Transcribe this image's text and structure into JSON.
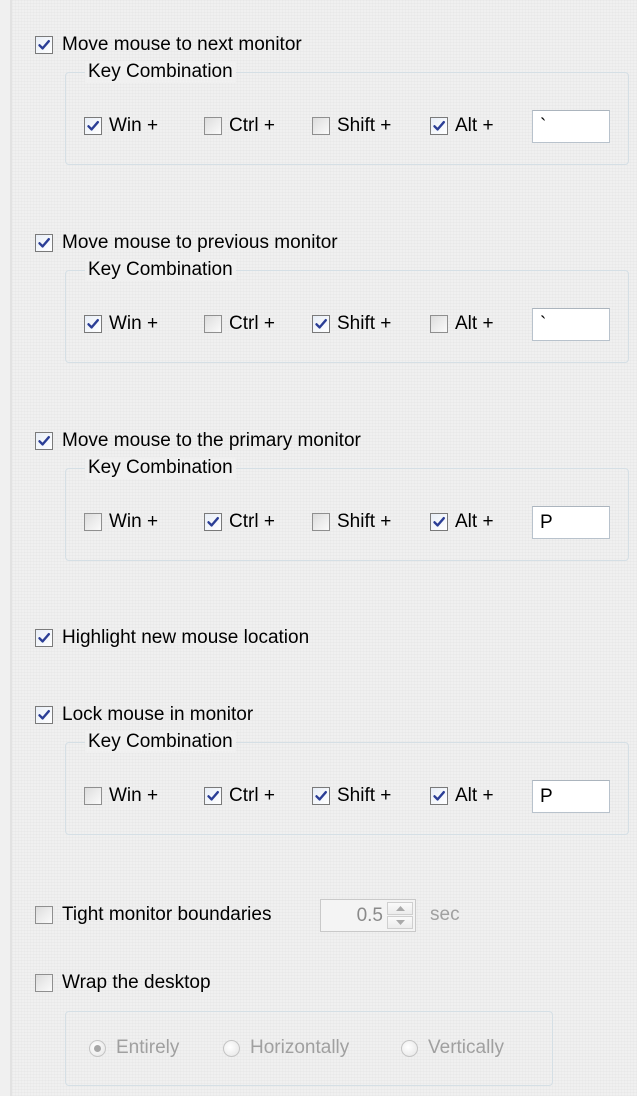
{
  "key_combination_label": "Key Combination",
  "sections": [
    {
      "title": "Move mouse to next monitor",
      "enabled": true,
      "keys": {
        "win": true,
        "ctrl": false,
        "shift": false,
        "alt": true
      },
      "key_value": "`"
    },
    {
      "title": "Move mouse to previous monitor",
      "enabled": true,
      "keys": {
        "win": true,
        "ctrl": false,
        "shift": true,
        "alt": false
      },
      "key_value": "`"
    },
    {
      "title": "Move mouse to the primary monitor",
      "enabled": true,
      "keys": {
        "win": false,
        "ctrl": true,
        "shift": false,
        "alt": true
      },
      "key_value": "P"
    },
    {
      "title": "Lock mouse in monitor",
      "enabled": true,
      "keys": {
        "win": false,
        "ctrl": true,
        "shift": true,
        "alt": true
      },
      "key_value": "P"
    }
  ],
  "modifier_labels": {
    "win": "Win +",
    "ctrl": "Ctrl +",
    "shift": "Shift +",
    "alt": "Alt +"
  },
  "highlight": {
    "label": "Highlight new mouse location",
    "checked": true
  },
  "tight": {
    "label": "Tight monitor boundaries",
    "checked": false,
    "value": "0.5",
    "unit": "sec"
  },
  "wrap": {
    "label": "Wrap the desktop",
    "checked": false,
    "options": [
      "Entirely",
      "Horizontally",
      "Vertically"
    ],
    "selected": "Entirely"
  },
  "colors": {
    "tick": "#2b3e96",
    "disabled_text": "#a0a0a0",
    "group_border": "#d5dfe5"
  }
}
